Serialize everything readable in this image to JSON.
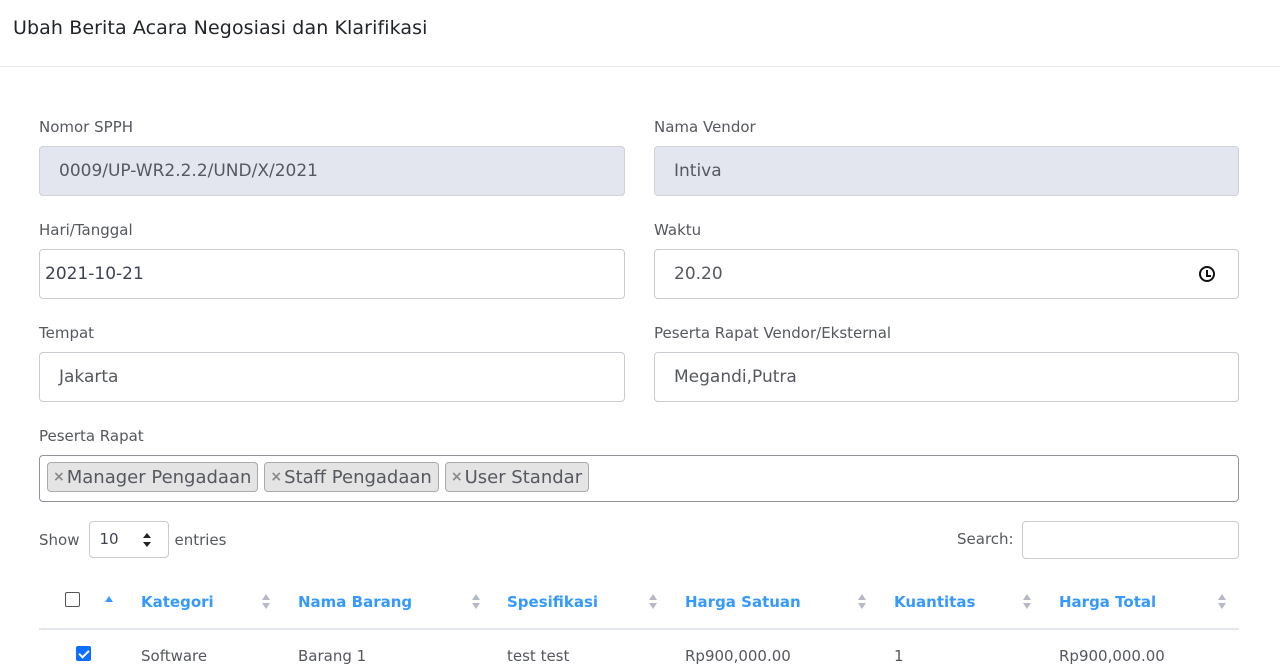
{
  "header": {
    "title": "Ubah Berita Acara Negosiasi dan Klarifikasi"
  },
  "form": {
    "nomor_spph": {
      "label": "Nomor SPPH",
      "value": "0009/UP-WR2.2.2/UND/X/2021"
    },
    "nama_vendor": {
      "label": "Nama Vendor",
      "value": "Intiva"
    },
    "hari_tanggal": {
      "label": "Hari/Tanggal",
      "value": "2021-10-21"
    },
    "waktu": {
      "label": "Waktu",
      "value": "20.20",
      "icon": "clock-icon"
    },
    "tempat": {
      "label": "Tempat",
      "value": "Jakarta"
    },
    "peserta_eksternal": {
      "label": "Peserta Rapat Vendor/Eksternal",
      "value": "Megandi,Putra"
    },
    "peserta_rapat": {
      "label": "Peserta Rapat",
      "remove_symbol": "×",
      "tags": [
        "Manager Pengadaan",
        "Staff Pengadaan",
        "User Standar"
      ]
    }
  },
  "table_controls": {
    "show_label": "Show",
    "entries_value": "10",
    "entries_label": "entries",
    "search_label": "Search:",
    "search_value": ""
  },
  "table": {
    "columns": [
      "Kategori",
      "Nama Barang",
      "Spesifikasi",
      "Harga Satuan",
      "Kuantitas",
      "Harga Total"
    ],
    "rows": [
      {
        "checked": true,
        "cells": [
          "Software",
          "Barang 1",
          "test test",
          "Rp900,000.00",
          "1",
          "Rp900,000.00"
        ]
      }
    ]
  },
  "colors": {
    "link_blue": "#3699ff",
    "checkbox_blue": "#0b6efd",
    "disabled_bg": "#e4e6ef"
  }
}
